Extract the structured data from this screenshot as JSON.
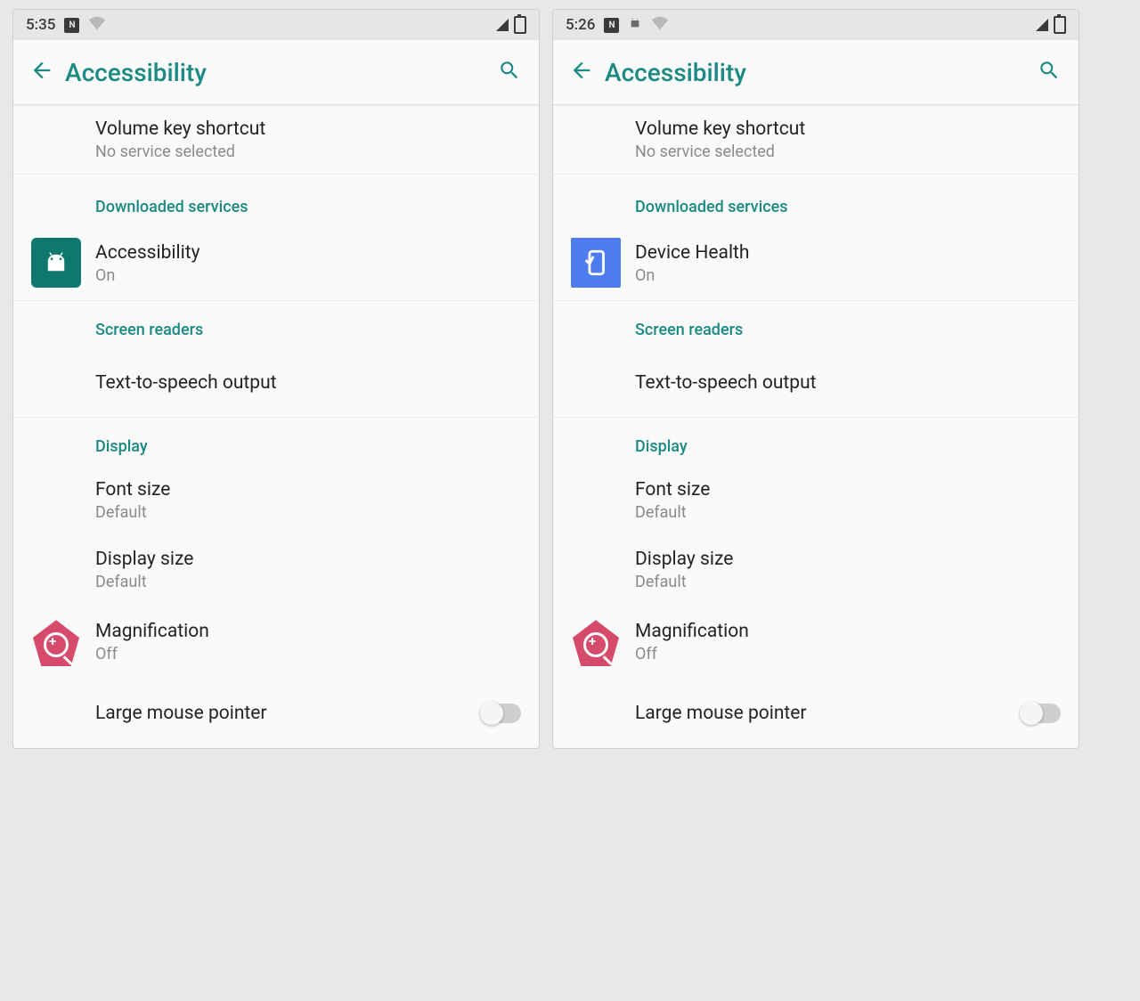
{
  "screens": [
    {
      "statusbar": {
        "time": "5:35",
        "icons": [
          "box",
          "wifi"
        ],
        "right": [
          "signal",
          "battery"
        ]
      },
      "appbar": {
        "title": "Accessibility"
      },
      "items": {
        "volume_shortcut": {
          "title": "Volume key shortcut",
          "sub": "No service selected"
        },
        "downloaded_header": "Downloaded services",
        "service": {
          "title": "Accessibility",
          "sub": "On",
          "icon": "android-teal"
        },
        "screen_readers_header": "Screen readers",
        "tts": {
          "title": "Text-to-speech output"
        },
        "display_header": "Display",
        "font_size": {
          "title": "Font size",
          "sub": "Default"
        },
        "display_size": {
          "title": "Display size",
          "sub": "Default"
        },
        "magnification": {
          "title": "Magnification",
          "sub": "Off"
        },
        "large_mouse": {
          "title": "Large mouse pointer",
          "toggle": "off"
        }
      }
    },
    {
      "statusbar": {
        "time": "5:26",
        "icons": [
          "box",
          "android",
          "wifi"
        ],
        "right": [
          "signal",
          "battery"
        ]
      },
      "appbar": {
        "title": "Accessibility"
      },
      "items": {
        "volume_shortcut": {
          "title": "Volume key shortcut",
          "sub": "No service selected"
        },
        "downloaded_header": "Downloaded services",
        "service": {
          "title": "Device Health",
          "sub": "On",
          "icon": "device-blue"
        },
        "screen_readers_header": "Screen readers",
        "tts": {
          "title": "Text-to-speech output"
        },
        "display_header": "Display",
        "font_size": {
          "title": "Font size",
          "sub": "Default"
        },
        "display_size": {
          "title": "Display size",
          "sub": "Default"
        },
        "magnification": {
          "title": "Magnification",
          "sub": "Off"
        },
        "large_mouse": {
          "title": "Large mouse pointer",
          "toggle": "off"
        }
      }
    }
  ]
}
